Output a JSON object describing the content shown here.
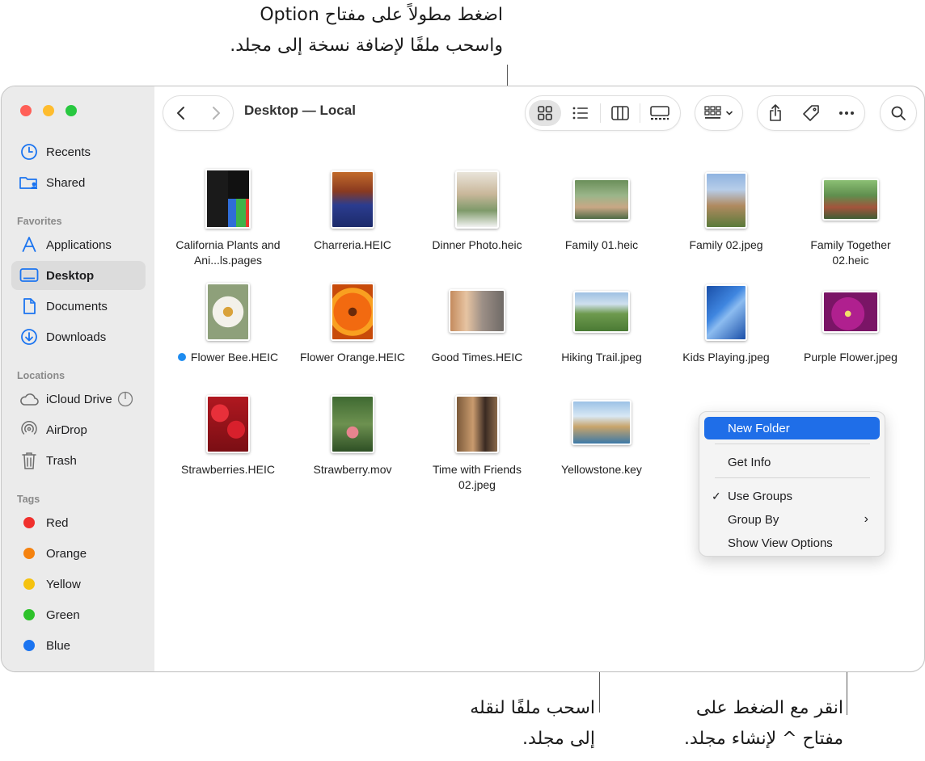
{
  "callouts": {
    "top": [
      "اضغط مطولاً على مفتاح Option",
      "واسحب ملفًا لإضافة نسخة إلى مجلد."
    ],
    "bottom_center": [
      "اسحب ملفًا لنقله",
      "إلى مجلد."
    ],
    "bottom_right": [
      "انقر مع الضغط على",
      "مفتاح ^ لإنشاء مجلد."
    ]
  },
  "window": {
    "title": "Desktop — Local"
  },
  "sidebar": {
    "top_items": [
      {
        "label": "Recents",
        "icon": "clock-icon"
      },
      {
        "label": "Shared",
        "icon": "shared-folder-icon"
      }
    ],
    "favorites_heading": "Favorites",
    "favorites": [
      {
        "label": "Applications",
        "icon": "applications-icon"
      },
      {
        "label": "Desktop",
        "icon": "desktop-icon",
        "selected": true
      },
      {
        "label": "Documents",
        "icon": "document-icon"
      },
      {
        "label": "Downloads",
        "icon": "download-icon"
      }
    ],
    "locations_heading": "Locations",
    "locations": [
      {
        "label": "iCloud Drive",
        "icon": "cloud-icon"
      },
      {
        "label": "AirDrop",
        "icon": "airdrop-icon"
      },
      {
        "label": "Trash",
        "icon": "trash-icon"
      }
    ],
    "tags_heading": "Tags",
    "tags": [
      {
        "label": "Red",
        "color": "#f0302d"
      },
      {
        "label": "Orange",
        "color": "#f5820f"
      },
      {
        "label": "Yellow",
        "color": "#f5c20f"
      },
      {
        "label": "Green",
        "color": "#2ec22a"
      },
      {
        "label": "Blue",
        "color": "#1b74f0"
      }
    ]
  },
  "files": [
    {
      "name": "California Plants and Ani...ls.pages"
    },
    {
      "name": "Charreria.HEIC"
    },
    {
      "name": "Dinner Photo.heic"
    },
    {
      "name": "Family 01.heic"
    },
    {
      "name": "Family 02.jpeg"
    },
    {
      "name": "Family Together 02.heic"
    },
    {
      "name": "Flower Bee.HEIC",
      "tag_color": "#1e8cf0"
    },
    {
      "name": "Flower Orange.HEIC"
    },
    {
      "name": "Good Times.HEIC"
    },
    {
      "name": "Hiking Trail.jpeg"
    },
    {
      "name": "Kids Playing.jpeg"
    },
    {
      "name": "Purple Flower.jpeg"
    },
    {
      "name": "Strawberries.HEIC"
    },
    {
      "name": "Strawberry.mov"
    },
    {
      "name": "Time with Friends 02.jpeg"
    },
    {
      "name": "Yellowstone.key"
    }
  ],
  "context_menu": {
    "items": [
      {
        "label": "New Folder",
        "highlighted": true
      },
      {
        "label": "Get Info"
      },
      {
        "label": "Use Groups",
        "checked": true,
        "check": "✓"
      },
      {
        "label": "Group By",
        "submenu": "›"
      },
      {
        "label": "Show View Options"
      }
    ]
  },
  "colors": {
    "accent": "#1f6ee8",
    "close": "#ff5f57",
    "minimize": "#febc2e",
    "zoom": "#28c840"
  }
}
